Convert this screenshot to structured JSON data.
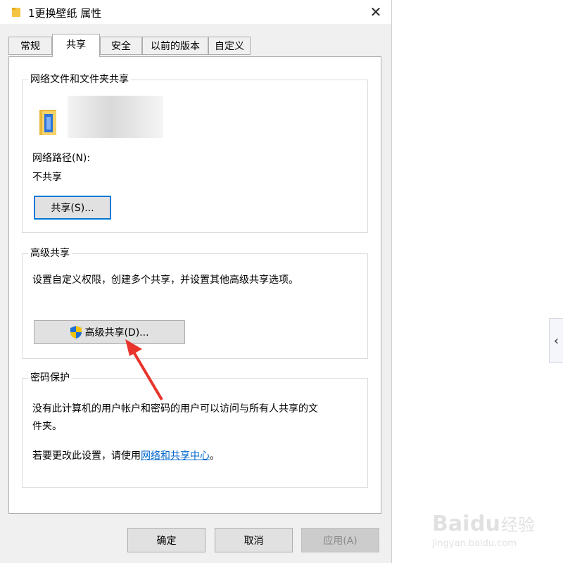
{
  "window": {
    "title": "1更换壁纸 属性",
    "close_glyph": "✕"
  },
  "tabs": [
    {
      "label": "常规"
    },
    {
      "label": "共享"
    },
    {
      "label": "安全"
    },
    {
      "label": "以前的版本"
    },
    {
      "label": "自定义"
    }
  ],
  "active_tab": "共享",
  "network_share": {
    "legend": "网络文件和文件夹共享",
    "path_label": "网络路径(N):",
    "path_value": "不共享",
    "share_button": "共享(S)..."
  },
  "advanced_share": {
    "legend": "高级共享",
    "description": "设置自定义权限，创建多个共享，并设置其他高级共享选项。",
    "button": "高级共享(D)..."
  },
  "password_protection": {
    "legend": "密码保护",
    "description_line1": "没有此计算机的用户帐户和密码的用户可以访问与所有人共享的文",
    "description_line2": "件夹。",
    "change_prefix": "若要更改此设置，请使用",
    "change_link": "网络和共享中心",
    "change_suffix": "。"
  },
  "footer": {
    "ok": "确定",
    "cancel": "取消",
    "apply": "应用(A)"
  },
  "side_handle_glyph": "‹",
  "watermark": {
    "brand": "Bai du 经验",
    "url": "jingyan.baidu.com"
  },
  "colors": {
    "accent": "#0078d7",
    "link": "#0066cc",
    "arrow": "#e8342c",
    "shield_blue": "#1f6fd1",
    "shield_yellow": "#f4c20d"
  }
}
